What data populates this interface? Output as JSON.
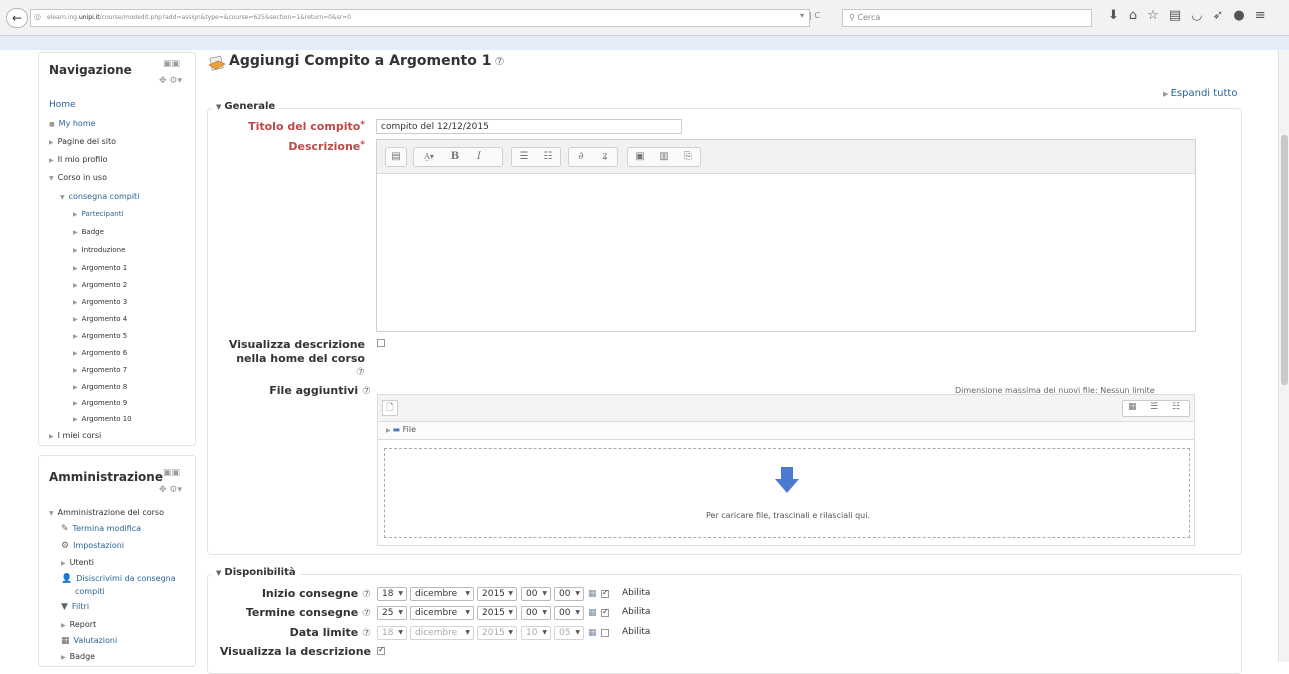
{
  "browser": {
    "url_prefix": "elearn.ing.",
    "url_host": "unipi.it",
    "url_rest": "/course/modedit.php?add=assign&type=&course=625&section=1&return=0&sr=0",
    "search_placeholder": "Cerca"
  },
  "nav_block": {
    "title": "Navigazione",
    "items": [
      {
        "label": "Home"
      },
      {
        "label": "My home"
      },
      {
        "label": "Pagine del sito"
      },
      {
        "label": "Il mio profilo"
      },
      {
        "label": "Corso in uso"
      },
      {
        "label": "consegna compiti"
      },
      {
        "label": "Partecipanti"
      },
      {
        "label": "Badge"
      },
      {
        "label": "Introduzione"
      },
      {
        "label": "Argomento 1"
      },
      {
        "label": "Argomento 2"
      },
      {
        "label": "Argomento 3"
      },
      {
        "label": "Argomento 4"
      },
      {
        "label": "Argomento 5"
      },
      {
        "label": "Argomento 6"
      },
      {
        "label": "Argomento 7"
      },
      {
        "label": "Argomento 8"
      },
      {
        "label": "Argomento 9"
      },
      {
        "label": "Argomento 10"
      },
      {
        "label": "I miei corsi"
      }
    ]
  },
  "admin_block": {
    "title": "Amministrazione",
    "items": [
      {
        "label": "Amministrazione del corso"
      },
      {
        "label": "Termina modifica"
      },
      {
        "label": "Impostazioni"
      },
      {
        "label": "Utenti"
      },
      {
        "label": "Disiscrivimi da consegna"
      },
      {
        "label": "compiti"
      },
      {
        "label": "Filtri"
      },
      {
        "label": "Report"
      },
      {
        "label": "Valutazioni"
      },
      {
        "label": "Badge"
      }
    ]
  },
  "page": {
    "heading": "Aggiungi Compito a Argomento 1",
    "expand_all": "Espandi tutto"
  },
  "generale": {
    "legend": "Generale",
    "title_label": "Titolo del compito",
    "title_value": "compito del 12/12/2015",
    "description_label": "Descrizione",
    "show_description_label_1": "Visualizza descrizione",
    "show_description_label_2": "nella home del corso",
    "files_label": "File aggiuntivi",
    "file_max": "Dimensione massima dei nuovi file: Nessun limite",
    "folder_name": "File",
    "drop_text": "Per caricare file, trascinali e rilasciali qui."
  },
  "disponibilita": {
    "legend": "Disponibilità",
    "rows": [
      {
        "label": "Inizio consegne",
        "day": "18",
        "month": "dicembre",
        "year": "2015",
        "hour": "00",
        "minute": "00",
        "enable": "Abilita",
        "enabled": true
      },
      {
        "label": "Termine consegne",
        "day": "25",
        "month": "dicembre",
        "year": "2015",
        "hour": "00",
        "minute": "00",
        "enable": "Abilita",
        "enabled": true
      },
      {
        "label": "Data limite",
        "day": "18",
        "month": "dicembre",
        "year": "2015",
        "hour": "10",
        "minute": "05",
        "enable": "Abilita",
        "enabled": false
      }
    ],
    "show_description_label": "Visualizza la descrizione"
  },
  "colors": {
    "link": "#2a6496",
    "required": "#b94a48",
    "drop_arrow": "#4a7bd0"
  }
}
